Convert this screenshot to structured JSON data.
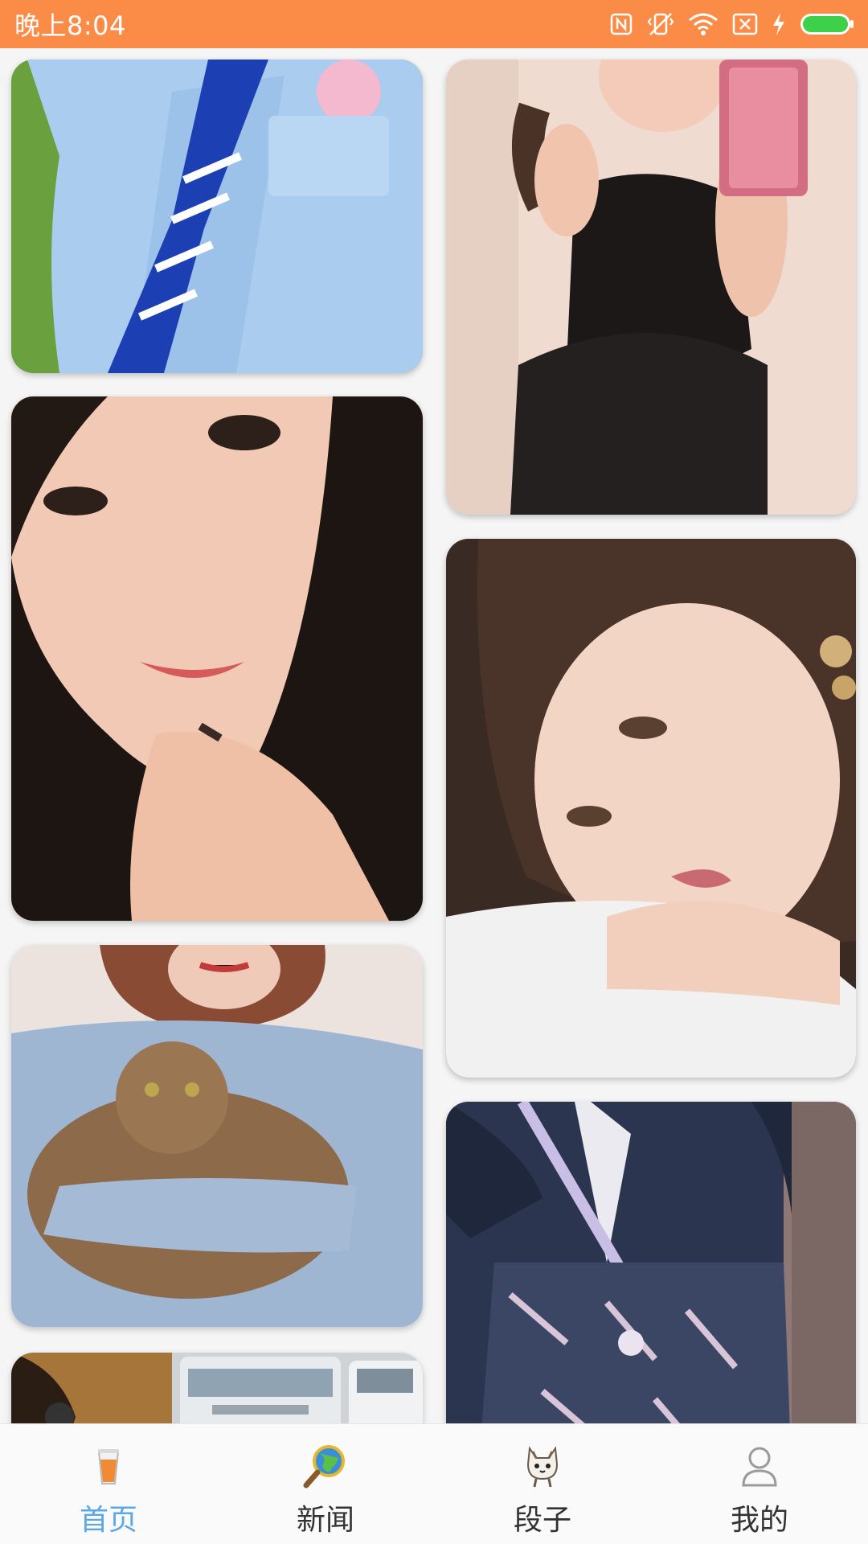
{
  "status_bar": {
    "time": "晚上8:04",
    "icons": [
      "nfc-icon",
      "vibrate-off-icon",
      "wifi-icon",
      "sim-off-icon",
      "charging-icon",
      "battery-icon"
    ],
    "background": "#fb8c47",
    "battery_color": "#3ed04a"
  },
  "feed": {
    "photos": [
      {
        "subject": "blue-uniform-cosplay"
      },
      {
        "subject": "mirror-selfie-black-dress"
      },
      {
        "subject": "closeup-face-long-hair"
      },
      {
        "subject": "portrait-resting-on-hand"
      },
      {
        "subject": "girl-holding-tabby-cat"
      },
      {
        "subject": "navy-lolita-dress"
      },
      {
        "subject": "street-with-trucks"
      }
    ]
  },
  "bottom_nav": {
    "active_color": "#5aa8e6",
    "tabs": [
      {
        "label": "首页",
        "icon": "juice-cup-icon",
        "active": true
      },
      {
        "label": "新闻",
        "icon": "globe-magnifier-icon",
        "active": false
      },
      {
        "label": "段子",
        "icon": "cat-icon",
        "active": false
      },
      {
        "label": "我的",
        "icon": "user-icon",
        "active": false
      }
    ]
  }
}
